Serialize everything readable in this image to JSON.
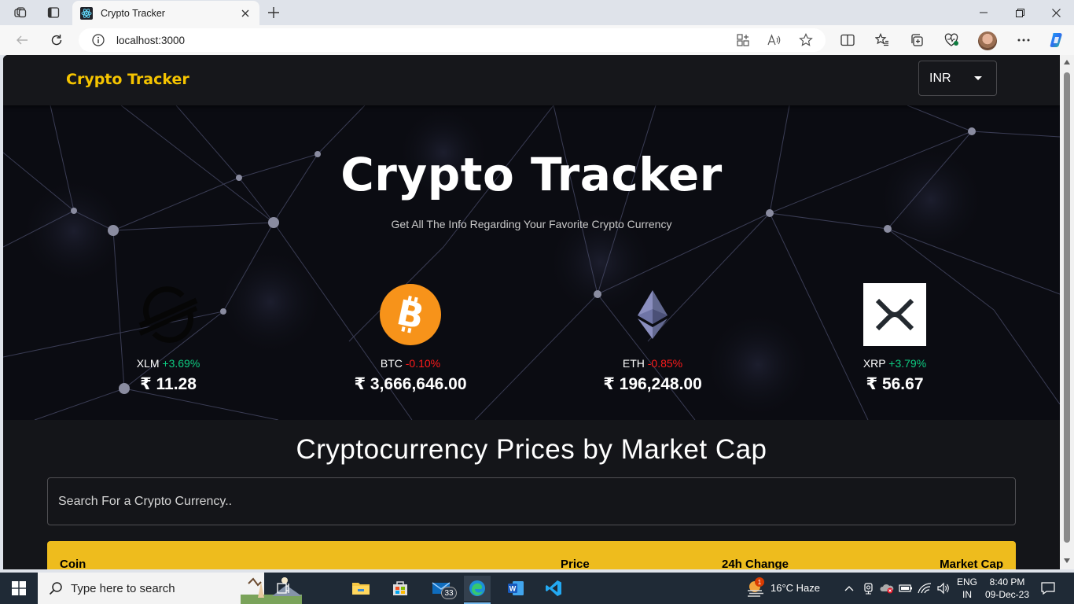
{
  "browser": {
    "tab_title": "Crypto Tracker",
    "url": "localhost:3000"
  },
  "app": {
    "brand": "Crypto Tracker",
    "currency": "INR",
    "hero_title": "Crypto Tracker",
    "hero_subtitle": "Get All The Info Regarding Your Favorite Crypto Currency",
    "coins": [
      {
        "symbol": "XLM",
        "change": "+3.69%",
        "price": "₹ 11.28",
        "trend": "up"
      },
      {
        "symbol": "BTC",
        "change": "-0.10%",
        "price": "₹ 3,666,646.00",
        "trend": "down"
      },
      {
        "symbol": "ETH",
        "change": "-0.85%",
        "price": "₹ 196,248.00",
        "trend": "down"
      },
      {
        "symbol": "XRP",
        "change": "+3.79%",
        "price": "₹ 56.67",
        "trend": "up"
      }
    ],
    "section_title": "Cryptocurrency Prices by Market Cap",
    "search_placeholder": "Search For a Crypto Currency..",
    "table_headers": {
      "coin": "Coin",
      "price": "Price",
      "change": "24h Change",
      "market_cap": "Market Cap"
    },
    "colors": {
      "accent": "#eebc1d",
      "brand": "#f5c400",
      "up": "#0ecb81",
      "down": "#ff1a1a"
    }
  },
  "taskbar": {
    "search_placeholder": "Type here to search",
    "mail_badge": "33",
    "weather_badge": "1",
    "weather": "16°C  Haze",
    "lang_1": "ENG",
    "lang_2": "IN",
    "time": "8:40 PM",
    "date": "09-Dec-23"
  }
}
